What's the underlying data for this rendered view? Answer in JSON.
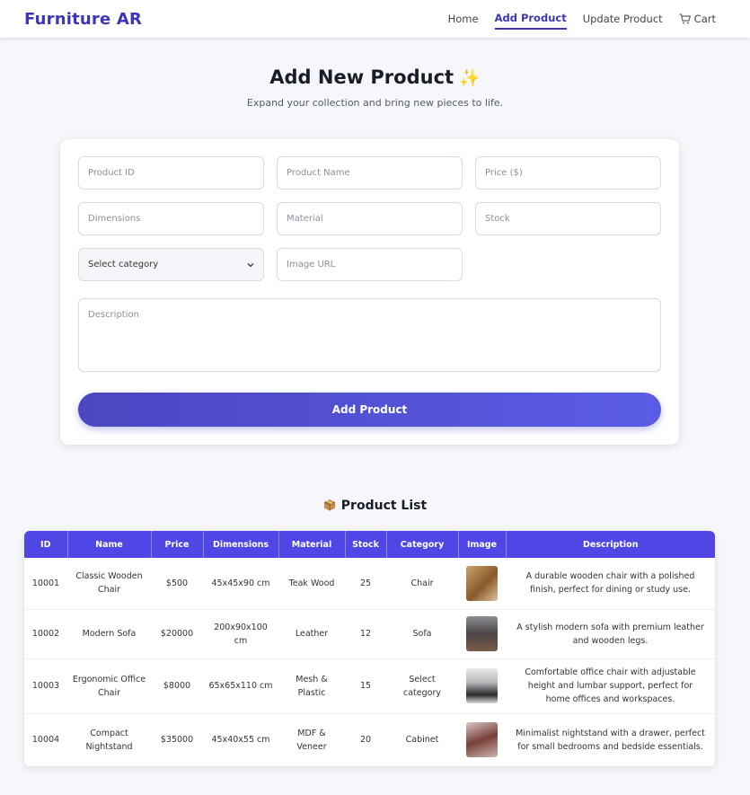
{
  "nav": {
    "brand": "Furniture AR",
    "links": [
      "Home",
      "Add Product",
      "Update Product",
      "Cart"
    ],
    "active": "Add Product"
  },
  "hero": {
    "title": "Add New Product",
    "title_emoji": "✨",
    "subtitle": "Expand your collection and bring new pieces to life."
  },
  "form": {
    "product_id_placeholder": "Product ID",
    "product_name_placeholder": "Product Name",
    "price_placeholder": "Price ($)",
    "dimensions_placeholder": "Dimensions",
    "material_placeholder": "Material",
    "stock_placeholder": "Stock",
    "category_selected": "Select category",
    "image_url_placeholder": "Image URL",
    "description_placeholder": "Description",
    "submit_label": "Add Product"
  },
  "product_list": {
    "title": "Product List",
    "columns": [
      "ID",
      "Name",
      "Price",
      "Dimensions",
      "Material",
      "Stock",
      "Category",
      "Image",
      "Description"
    ],
    "rows": [
      {
        "id": "10001",
        "name": "Classic Wooden Chair",
        "price": "$500",
        "dimensions": "45x45x90 cm",
        "material": "Teak Wood",
        "stock": "25",
        "category": "Chair",
        "description": "A durable wooden chair with a polished finish, perfect for dining or study use."
      },
      {
        "id": "10002",
        "name": "Modern Sofa",
        "price": "$20000",
        "dimensions": "200x90x100 cm",
        "material": "Leather",
        "stock": "12",
        "category": "Sofa",
        "description": "A stylish modern sofa with premium leather and wooden legs."
      },
      {
        "id": "10003",
        "name": "Ergonomic Office Chair",
        "price": "$8000",
        "dimensions": "65x65x110 cm",
        "material": "Mesh & Plastic",
        "stock": "15",
        "category": "Select category",
        "description": "Comfortable office chair with adjustable height and lumbar support, perfect for home offices and workspaces."
      },
      {
        "id": "10004",
        "name": "Compact Nightstand",
        "price": "$35000",
        "dimensions": "45x40x55 cm",
        "material": "MDF & Veneer",
        "stock": "20",
        "category": "Cabinet",
        "description": "Minimalist nightstand with a drawer, perfect for small bedrooms and bedside essentials."
      }
    ]
  },
  "colors": {
    "brand": "#3e36b8",
    "table_header": "#4f46e5",
    "button_start": "#4b46c1",
    "button_end": "#5b5ce6"
  }
}
